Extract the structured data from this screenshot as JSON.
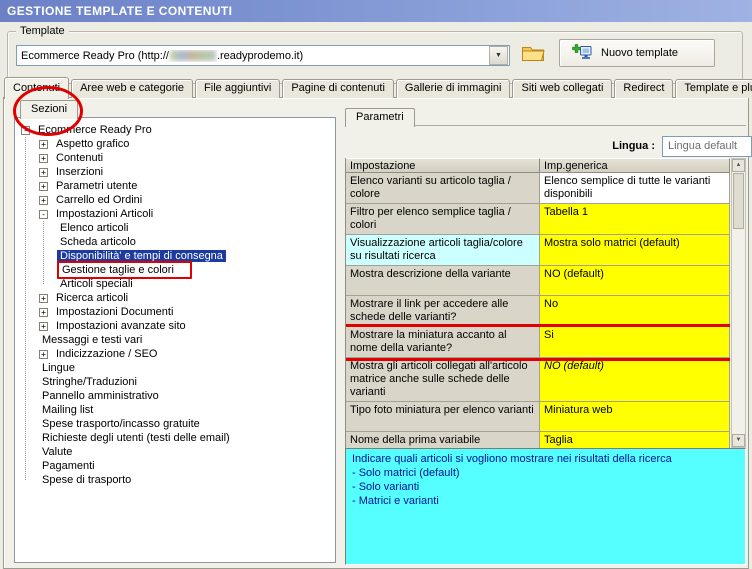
{
  "window": {
    "title": "GESTIONE TEMPLATE E CONTENUTI"
  },
  "template_section": {
    "label": "Template",
    "combo": {
      "prefix": "Ecommerce Ready Pro (http://",
      "suffix": ".readyprodemo.it)"
    },
    "new_template_button": "Nuovo template"
  },
  "tabs": [
    "Contenuti",
    "Aree web e categorie",
    "File aggiuntivi",
    "Pagine di contenuti",
    "Gallerie di immagini",
    "Siti web collegati",
    "Redirect",
    "Template e plugins"
  ],
  "active_tab": 0,
  "sections_panel": {
    "tab_label": "Sezioni",
    "tree": [
      {
        "label": "Ecommerce Ready Pro",
        "level": 0,
        "expander": "minus"
      },
      {
        "label": "Aspetto grafico",
        "level": 1,
        "expander": "plus"
      },
      {
        "label": "Contenuti",
        "level": 1,
        "expander": "plus"
      },
      {
        "label": "Inserzioni",
        "level": 1,
        "expander": "plus"
      },
      {
        "label": "Parametri utente",
        "level": 1,
        "expander": "plus"
      },
      {
        "label": "Carrello ed Ordini",
        "level": 1,
        "expander": "plus"
      },
      {
        "label": "Impostazioni Articoli",
        "level": 1,
        "expander": "minus"
      },
      {
        "label": "Elenco articoli",
        "level": 2,
        "expander": "none"
      },
      {
        "label": "Scheda articolo",
        "level": 2,
        "expander": "none"
      },
      {
        "label": "Disponibilità' e tempi di consegna",
        "level": 2,
        "expander": "none",
        "selected": true
      },
      {
        "label": "Gestione taglie e colori",
        "level": 2,
        "expander": "none",
        "annotated": true
      },
      {
        "label": "Articoli speciali",
        "level": 2,
        "expander": "none"
      },
      {
        "label": "Ricerca articoli",
        "level": 1,
        "expander": "plus"
      },
      {
        "label": "Impostazioni Documenti",
        "level": 1,
        "expander": "plus"
      },
      {
        "label": "Impostazioni avanzate sito",
        "level": 1,
        "expander": "plus"
      },
      {
        "label": "Messaggi e testi vari",
        "level": 1,
        "expander": "none"
      },
      {
        "label": "Indicizzazione / SEO",
        "level": 1,
        "expander": "plus"
      },
      {
        "label": "Lingue",
        "level": 1,
        "expander": "none"
      },
      {
        "label": "Stringhe/Traduzioni",
        "level": 1,
        "expander": "none"
      },
      {
        "label": "Pannello amministrativo",
        "level": 1,
        "expander": "none"
      },
      {
        "label": "Mailing list",
        "level": 1,
        "expander": "none"
      },
      {
        "label": "Spese trasporto/incasso gratuite",
        "level": 1,
        "expander": "none"
      },
      {
        "label": "Richieste degli utenti (testi delle email)",
        "level": 1,
        "expander": "none"
      },
      {
        "label": "Valute",
        "level": 1,
        "expander": "none"
      },
      {
        "label": "Pagamenti",
        "level": 1,
        "expander": "none"
      },
      {
        "label": "Spese di trasporto",
        "level": 1,
        "expander": "none"
      }
    ]
  },
  "parameters_panel": {
    "tab_label": "Parametri",
    "language_label": "Lingua :",
    "language_value": "Lingua default",
    "table": {
      "headers": [
        "Impostazione",
        "Imp.generica"
      ],
      "rows": [
        {
          "setting": "Elenco varianti su articolo taglia / colore",
          "value": "Elenco semplice di tutte le varianti disponibili",
          "value_bg": "#FFFFFF"
        },
        {
          "setting": "Filtro per elenco semplice taglia / colori",
          "value": "Tabella 1",
          "value_bg": "#FFFF00"
        },
        {
          "setting": "Visualizzazione articoli taglia/colore su risultati ricerca",
          "value": "Mostra solo matrici (default)",
          "value_bg": "#FFFF00",
          "setting_bg": "#CCFFFF"
        },
        {
          "setting": "Mostra descrizione della variante",
          "value": "NO (default)",
          "value_bg": "#FFFF00"
        },
        {
          "setting": "Mostrare il link per accedere alle schede delle varianti?",
          "value": "No",
          "value_bg": "#FFFF00"
        },
        {
          "setting": "Mostrare la miniatura accanto al nome della variante?",
          "value": "Si",
          "value_bg": "#FFFF00",
          "annotated": true
        },
        {
          "setting": "Mostra gli articoli collegati all'articolo matrice anche sulle schede delle varianti",
          "value": "NO (default)",
          "value_bg": "#FFFF00",
          "italic": true
        },
        {
          "setting": "Tipo foto miniatura per elenco varianti",
          "value": "Miniatura web",
          "value_bg": "#FFFF00"
        },
        {
          "setting": "Nome della prima variabile",
          "value": "Taglia",
          "value_bg": "#FFFF00"
        }
      ]
    },
    "info_box": [
      "Indicare quali articoli si vogliono mostrare nei risultati della ricerca",
      "- Solo matrici (default)",
      "- Solo varianti",
      "- Matrici e varianti"
    ]
  },
  "colors": {
    "selection": "#1C3AA0",
    "annotation": "#E00000",
    "info_bg": "#55FFFF",
    "yellow": "#FFFF00",
    "cyan_cell": "#CCFFFF"
  }
}
